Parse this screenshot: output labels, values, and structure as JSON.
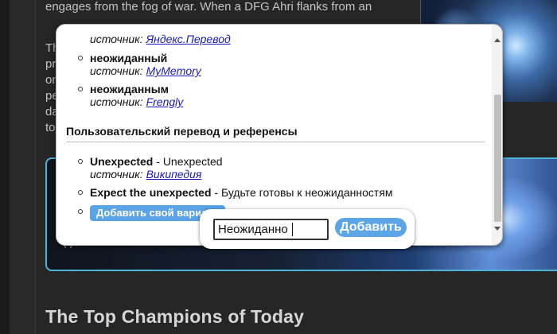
{
  "background": {
    "paragraph_lines": [
      "engages from the fog of war. When a DFG Ahri flanks from an"
    ],
    "paragraph2_fragments": [
      "Th",
      "pr",
      "on",
      "pe",
      "da",
      "to"
    ],
    "banner_fragment": "(  )",
    "heading": "The Top Champions of Today"
  },
  "popup": {
    "entries": [
      {
        "term": "",
        "source_label": "источник:",
        "source_name": "Яндекс.Перевод"
      },
      {
        "term": "неожиданный",
        "source_label": "источник:",
        "source_name": "MyMemory"
      },
      {
        "term": "неожиданным",
        "source_label": "источник:",
        "source_name": "Frengly"
      }
    ],
    "section_title": "Пользовательский перевод и референсы",
    "references": [
      {
        "term": "Unexpected",
        "sep": " - ",
        "translation": "Unexpected",
        "source_label": "источник:",
        "source_name": "Википедия"
      },
      {
        "term": "Expect the unexpected",
        "sep": " - ",
        "translation": "Будьте готовы к неожиданностям"
      }
    ],
    "add_variant_label": "Добавить свой вариант"
  },
  "add_box": {
    "input_value": "Неожиданно",
    "submit_label": "Добавить"
  },
  "colors": {
    "link": "#1a1ab8",
    "button": "#5ca6e6",
    "banner_border": "#4fb3d8"
  }
}
